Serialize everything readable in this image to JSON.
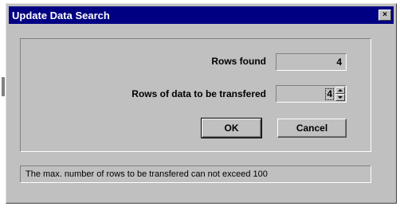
{
  "window": {
    "title": "Update Data Search",
    "close_symbol": "×"
  },
  "form": {
    "rows_found_label": "Rows found",
    "rows_found_value": "4",
    "rows_transfer_label": "Rows of data to be transfered",
    "rows_transfer_value": "4"
  },
  "buttons": {
    "ok_label": "OK",
    "cancel_label": "Cancel"
  },
  "status": {
    "message": "The max. number of rows to be transfered can not exceed 100"
  },
  "icons": {
    "close": "close-icon",
    "spin_up": "spin-up-icon",
    "spin_down": "spin-down-icon"
  },
  "colors": {
    "titlebar": "#000082",
    "face": "#c0c0c0"
  }
}
